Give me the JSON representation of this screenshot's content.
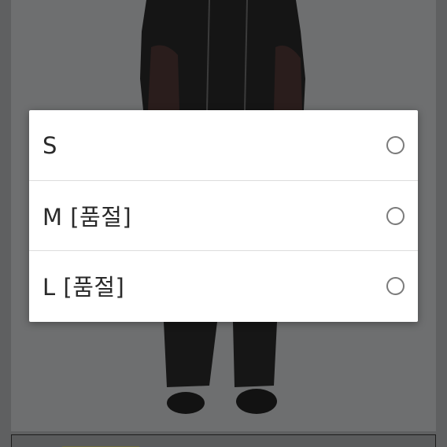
{
  "size_dialog": {
    "options": [
      {
        "label": "S",
        "selected": false
      },
      {
        "label": "M [품절]",
        "selected": false
      },
      {
        "label": "L [품절]",
        "selected": false
      }
    ]
  },
  "colors": {
    "dim_background": "#5f6061",
    "dialog_background": "#ffffff",
    "radio_border": "#7b7b7b",
    "text": "#2a2a2a"
  },
  "icons": {
    "radio": "radio-unchecked-icon"
  }
}
